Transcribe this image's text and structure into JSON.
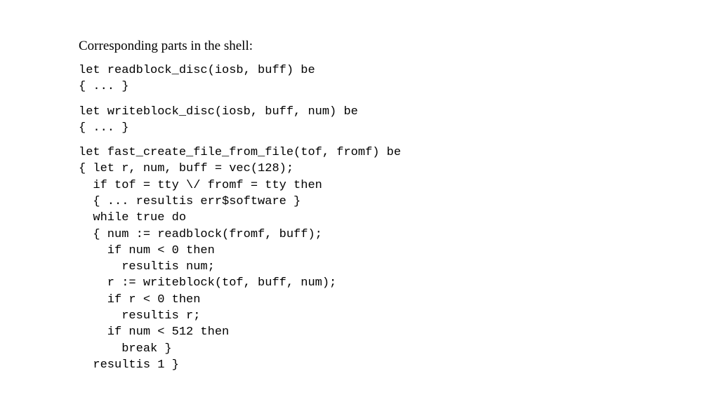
{
  "heading": "Corresponding parts in the shell:",
  "code1": "let readblock_disc(iosb, buff) be\n{ ... }",
  "code2": "let writeblock_disc(iosb, buff, num) be\n{ ... }",
  "code3": "let fast_create_file_from_file(tof, fromf) be\n{ let r, num, buff = vec(128);\n  if tof = tty \\/ fromf = tty then\n  { ... resultis err$software }\n  while true do\n  { num := readblock(fromf, buff);\n    if num < 0 then\n      resultis num;\n    r := writeblock(tof, buff, num);\n    if r < 0 then\n      resultis r;\n    if num < 512 then\n      break }\n  resultis 1 }"
}
